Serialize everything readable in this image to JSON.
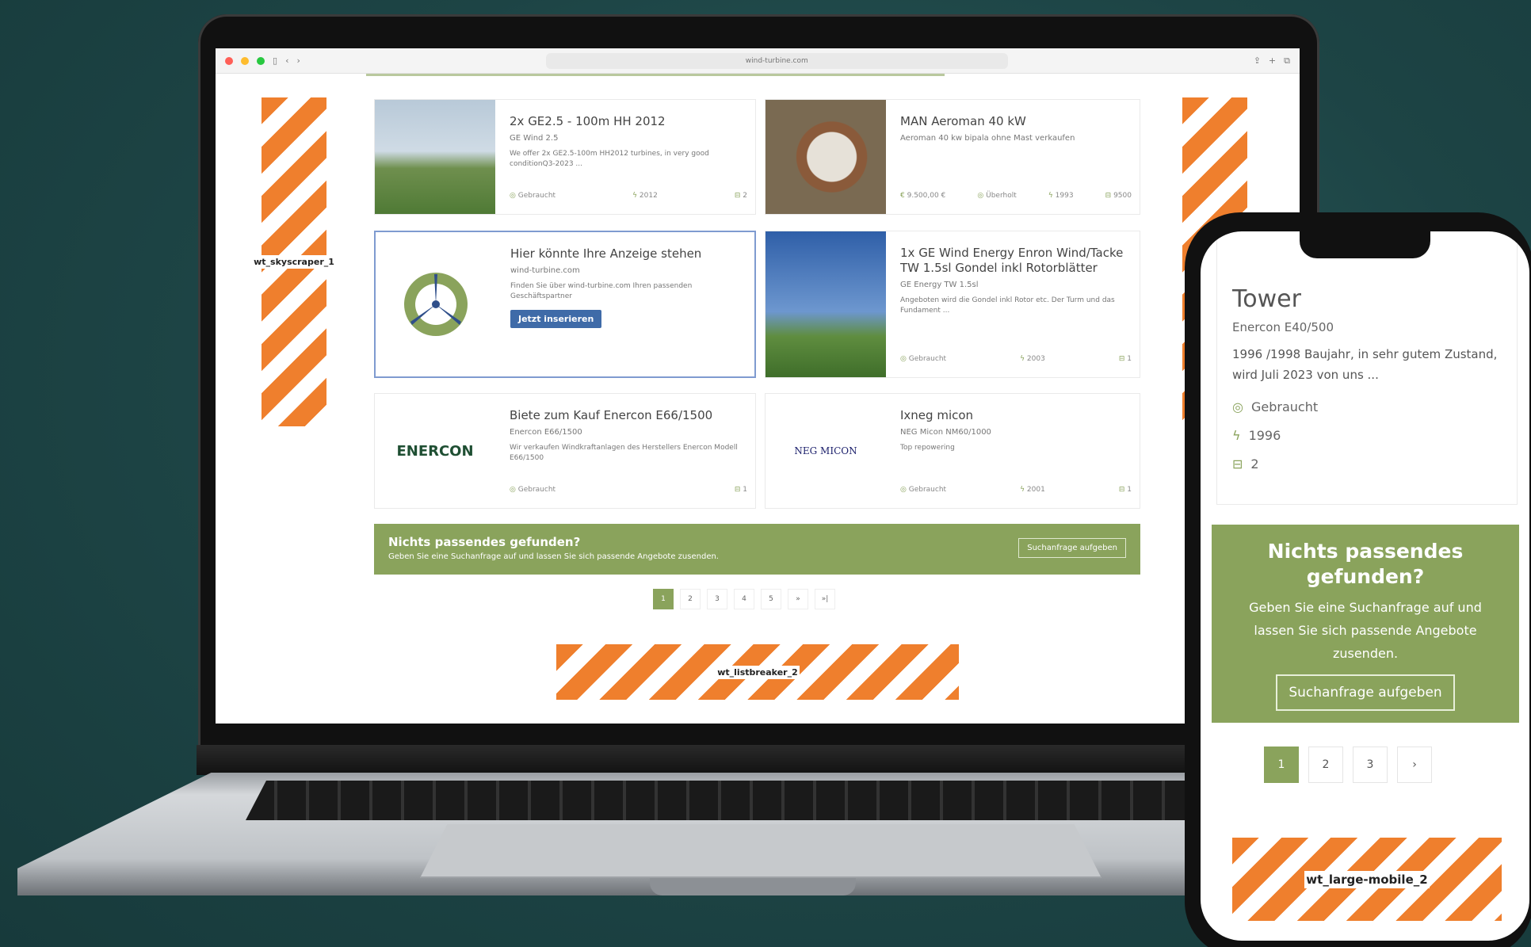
{
  "browser": {
    "url": "wind-turbine.com"
  },
  "ads": {
    "skyscraper": "wt_skyscraper_1",
    "listbreaker": "wt_listbreaker_2",
    "mobile": "wt_large-mobile_2"
  },
  "listings": [
    {
      "title": "2x GE2.5 - 100m HH 2012",
      "subtitle": "GE Wind 2.5",
      "desc": "We offer 2x GE2.5-100m HH2012 turbines, in very good conditionQ3-2023 ...",
      "condition": "Gebraucht",
      "year": "2012",
      "count": "2"
    },
    {
      "title": "MAN Aeroman 40 kW",
      "subtitle": "Aeroman 40 kw bipala ohne Mast verkaufen",
      "price": "9.500,00 €",
      "condition": "Überholt",
      "year": "1993",
      "count": "9500"
    },
    {
      "title": "Hier könnte Ihre Anzeige stehen",
      "subtitle": "wind-turbine.com",
      "desc": "Finden Sie über wind-turbine.com Ihren passenden Geschäftspartner",
      "button": "Jetzt inserieren"
    },
    {
      "title": "1x GE Wind Energy Enron Wind/Tacke TW 1.5sl Gondel inkl Rotorblätter",
      "subtitle": "GE Energy TW 1.5sl",
      "desc": "Angeboten wird die Gondel inkl Rotor etc. Der Turm und das Fundament ...",
      "condition": "Gebraucht",
      "year": "2003",
      "count": "1"
    },
    {
      "title": "Biete zum Kauf Enercon E66/1500",
      "subtitle": "Enercon E66/1500",
      "desc": "Wir verkaufen Windkraftanlagen des Herstellers Enercon Modell E66/1500",
      "condition": "Gebraucht",
      "count": "1",
      "logo": "ENERCON"
    },
    {
      "title": "Ixneg micon",
      "subtitle": "NEG Micon NM60/1000",
      "desc": "Top repowering",
      "condition": "Gebraucht",
      "year": "2001",
      "count": "1",
      "logo": "NEG MICON"
    }
  ],
  "banner": {
    "title": "Nichts passendes gefunden?",
    "text": "Geben Sie eine Suchanfrage auf und lassen Sie sich passende Angebote zusenden.",
    "button": "Suchanfrage aufgeben"
  },
  "pagination": [
    "1",
    "2",
    "3",
    "4",
    "5",
    "»",
    "»|"
  ],
  "mobile": {
    "title": "Tower",
    "subtitle": "Enercon E40/500",
    "desc": "1996 /1998 Baujahr, in sehr gutem Zustand, wird Juli 2023 von uns ...",
    "condition": "Gebraucht",
    "year": "1996",
    "count": "2",
    "banner_title": "Nichts passendes gefunden?",
    "banner_text": "Geben Sie eine Suchanfrage auf und lassen Sie sich passende Angebote zusenden.",
    "banner_button": "Suchanfrage aufgeben",
    "pagination": [
      "1",
      "2",
      "3",
      "›"
    ]
  }
}
